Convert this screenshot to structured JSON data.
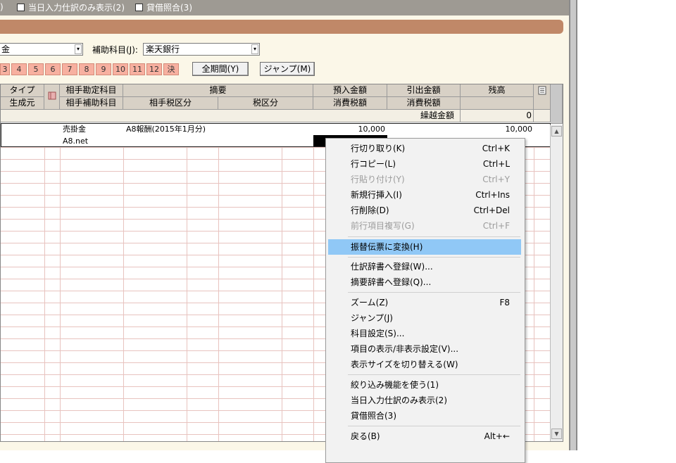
{
  "topbar": {
    "item1_fragment": ")",
    "item2": "当日入力仕訳のみ表示(2)",
    "item3": "貸借照合(3)"
  },
  "filter": {
    "account_select_value": "金",
    "sub_account_label": "補助科目(J):",
    "sub_account_value": "楽天銀行"
  },
  "months": [
    "3",
    "4",
    "5",
    "6",
    "7",
    "8",
    "9",
    "10",
    "11",
    "12",
    "決"
  ],
  "buttons": {
    "all_period": "全期間(Y)",
    "jump": "ジャンプ(M)"
  },
  "grid": {
    "headers_row1": {
      "type": "タイプ",
      "counter_account": "相手勘定科目",
      "description": "摘要",
      "deposit": "預入金額",
      "withdrawal": "引出金額",
      "balance": "残高"
    },
    "headers_row2": {
      "origin": "生成元",
      "counter_sub_account": "相手補助科目",
      "counter_tax_category": "相手税区分",
      "tax_category": "税区分",
      "deposit_tax": "消費税額",
      "withdrawal_tax": "消費税額"
    },
    "carryover": {
      "label": "繰越金額",
      "value": "0"
    },
    "rows": [
      {
        "counter_account": "売掛金",
        "counter_sub_account": "A8.net",
        "description": "A8報酬(2015年1月分)",
        "deposit": "10,000",
        "balance": "10,000"
      }
    ]
  },
  "context_menu": {
    "items": [
      {
        "label": "行切り取り(K)",
        "shortcut": "Ctrl+K",
        "disabled": false,
        "highlighted": false
      },
      {
        "label": "行コピー(L)",
        "shortcut": "Ctrl+L",
        "disabled": false,
        "highlighted": false
      },
      {
        "label": "行貼り付け(Y)",
        "shortcut": "Ctrl+Y",
        "disabled": true,
        "highlighted": false
      },
      {
        "label": "新規行挿入(I)",
        "shortcut": "Ctrl+Ins",
        "disabled": false,
        "highlighted": false
      },
      {
        "label": "行削除(D)",
        "shortcut": "Ctrl+Del",
        "disabled": false,
        "highlighted": false
      },
      {
        "label": "前行項目複写(G)",
        "shortcut": "Ctrl+F",
        "disabled": true,
        "highlighted": false
      },
      {
        "label": "振替伝票に変換(H)",
        "shortcut": "",
        "disabled": false,
        "highlighted": true
      },
      {
        "label": "仕訳辞書へ登録(W)...",
        "shortcut": "",
        "disabled": false,
        "highlighted": false
      },
      {
        "label": "摘要辞書へ登録(Q)...",
        "shortcut": "",
        "disabled": false,
        "highlighted": false
      },
      {
        "label": "ズーム(Z)",
        "shortcut": "F8",
        "disabled": false,
        "highlighted": false
      },
      {
        "label": "ジャンプ(J)",
        "shortcut": "",
        "disabled": false,
        "highlighted": false
      },
      {
        "label": "科目設定(S)...",
        "shortcut": "",
        "disabled": false,
        "highlighted": false
      },
      {
        "label": "項目の表示/非表示設定(V)...",
        "shortcut": "",
        "disabled": false,
        "highlighted": false
      },
      {
        "label": "表示サイズを切り替える(W)",
        "shortcut": "",
        "disabled": false,
        "highlighted": false
      },
      {
        "label": "絞り込み機能を使う(1)",
        "shortcut": "",
        "disabled": false,
        "highlighted": false
      },
      {
        "label": "当日入力仕訳のみ表示(2)",
        "shortcut": "",
        "disabled": false,
        "highlighted": false
      },
      {
        "label": "貸借照合(3)",
        "shortcut": "",
        "disabled": false,
        "highlighted": false
      },
      {
        "label": "戻る(B)",
        "shortcut": "Alt+←",
        "disabled": false,
        "highlighted": false
      }
    ]
  },
  "colors": {
    "window_bg": "#fbf7e8",
    "orange_bar": "#c08868",
    "month_bg": "#f7b0a0",
    "header_bg": "#d8d1c6",
    "menu_highlight": "#90c8f6",
    "grid_line": "#e8c3bf"
  },
  "icons": [
    "notebook-icon",
    "memo-icon",
    "checkbox-icon",
    "dropdown-arrow-icon",
    "scroll-up-icon",
    "scroll-down-icon"
  ]
}
